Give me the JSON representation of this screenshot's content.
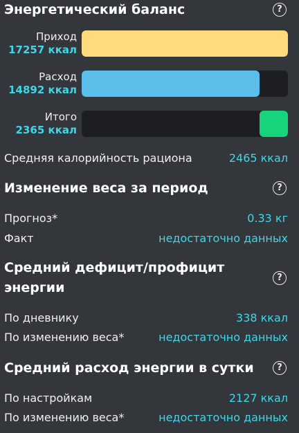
{
  "energy_balance": {
    "title": "Энергетический баланс",
    "bars": [
      {
        "label": "Приход",
        "value": "17257 ккал",
        "fill_fraction": 1.0,
        "color": "#fedc7d"
      },
      {
        "label": "Расход",
        "value": "14892 ккал",
        "fill_fraction": 0.863,
        "color": "#5bbde9"
      },
      {
        "label": "Итого",
        "value": "2365 ккал",
        "fill_fraction": 0.137,
        "color": "#17d47c"
      }
    ],
    "avg_calorie": {
      "label": "Средняя калорийность рациона",
      "value": "2465 ккал"
    }
  },
  "weight_change": {
    "title": "Изменение веса за период",
    "rows": [
      {
        "label": "Прогноз*",
        "value": "0.33 кг"
      },
      {
        "label": "Факт",
        "value": "недостаточно данных"
      }
    ]
  },
  "avg_deficit": {
    "title_line1": "Средний дефицит/профицит",
    "title_line2": "энергии",
    "rows": [
      {
        "label": "По дневнику",
        "value": "338 ккал"
      },
      {
        "label": "По изменению веса*",
        "value": "недостаточно данных"
      }
    ]
  },
  "avg_expenditure": {
    "title": "Средний расход энергии в сутки",
    "rows": [
      {
        "label": "По настройкам",
        "value": "2127 ккал"
      },
      {
        "label": "По изменению веса*",
        "value": "недостаточно данных"
      }
    ]
  },
  "help_icon_glyph": "?",
  "colors": {
    "background": "#33373c",
    "accent": "#3fd6e8",
    "track": "#1c1e21"
  }
}
